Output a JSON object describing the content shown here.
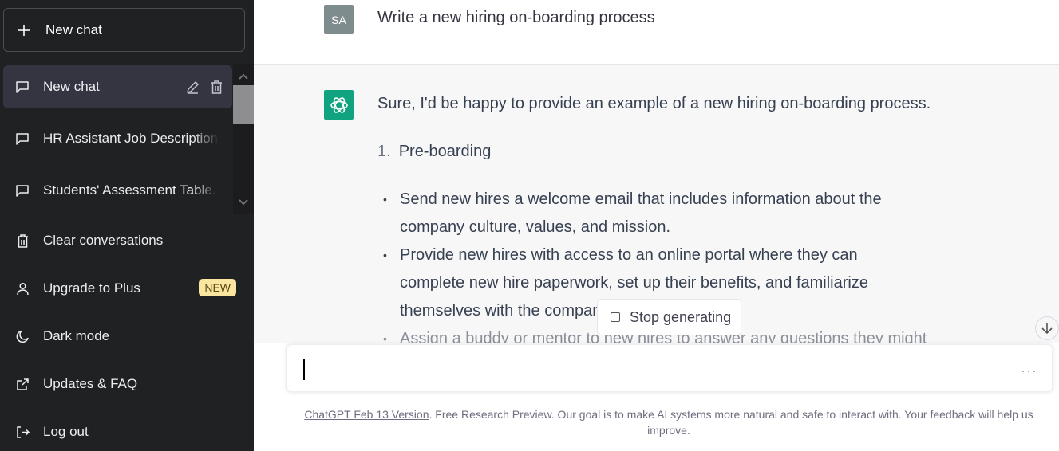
{
  "sidebar": {
    "new_chat_label": "New chat",
    "history": [
      {
        "label": "New chat",
        "active": true
      },
      {
        "label": "HR Assistant Job Description",
        "active": false
      },
      {
        "label": "Students' Assessment Table.",
        "active": false
      }
    ],
    "menu": [
      {
        "label": "Clear conversations",
        "icon": "trash-icon"
      },
      {
        "label": "Upgrade to Plus",
        "icon": "user-icon",
        "badge": "NEW"
      },
      {
        "label": "Dark mode",
        "icon": "moon-icon"
      },
      {
        "label": "Updates & FAQ",
        "icon": "external-link-icon"
      },
      {
        "label": "Log out",
        "icon": "logout-icon"
      }
    ]
  },
  "conversation": {
    "user_avatar": "SA",
    "user_message": "Write a new hiring on-boarding process",
    "bot_intro": "Sure, I'd be happy to provide an example of a new hiring on-boarding process.",
    "list_number": "1.",
    "list_title": "Pre-boarding",
    "bullets": [
      "Send new hires a welcome email that includes information about the company culture, values, and mission.",
      "Provide new hires with access to an online portal where they can complete new hire paperwork, set up their benefits, and familiarize themselves with the company policies.",
      "Assign a buddy or mentor to new hires to answer any questions they might"
    ]
  },
  "controls": {
    "stop_generating": "Stop generating",
    "input_value": "",
    "more": "···"
  },
  "footer": {
    "version_link": "ChatGPT Feb 13 Version",
    "note": ". Free Research Preview. Our goal is to make AI systems more natural and safe to interact with. Your feedback will help us improve."
  },
  "colors": {
    "sidebar_bg": "#202123",
    "active_item_bg": "#343541",
    "bot_avatar": "#10a37f",
    "user_avatar": "#7f8c8d",
    "badge_bg": "#fae69e"
  }
}
